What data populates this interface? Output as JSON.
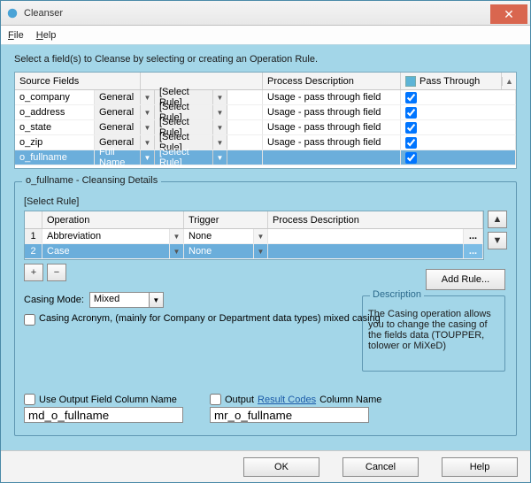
{
  "window": {
    "title": "Cleanser"
  },
  "menu": {
    "file": "File",
    "help": "Help"
  },
  "instruction": "Select a field(s) to Cleanse by selecting or creating an Operation Rule.",
  "grid": {
    "headers": {
      "source": "Source Fields",
      "process": "Process Description",
      "pass": "Pass Through"
    },
    "rows": [
      {
        "name": "o_company",
        "type": "General",
        "rule": "[Select Rule]",
        "desc": "Usage - pass through field",
        "pass": true,
        "selected": false
      },
      {
        "name": "o_address",
        "type": "General",
        "rule": "[Select Rule]",
        "desc": "Usage - pass through field",
        "pass": true,
        "selected": false
      },
      {
        "name": "o_state",
        "type": "General",
        "rule": "[Select Rule]",
        "desc": "Usage - pass through field",
        "pass": true,
        "selected": false
      },
      {
        "name": "o_zip",
        "type": "General",
        "rule": "[Select Rule]",
        "desc": "Usage - pass through field",
        "pass": true,
        "selected": false
      },
      {
        "name": "o_fullname",
        "type": "Full Name",
        "rule": "[Select Rule]",
        "desc": "",
        "pass": true,
        "selected": true
      }
    ]
  },
  "details": {
    "title": "o_fullname - Cleansing Details",
    "rule_label": "[Select Rule]",
    "headers": {
      "op": "Operation",
      "trig": "Trigger",
      "desc": "Process Description"
    },
    "rows": [
      {
        "idx": "1",
        "op": "Abbreviation",
        "trig": "None",
        "desc": "",
        "selected": false
      },
      {
        "idx": "2",
        "op": "Case",
        "trig": "None",
        "desc": "",
        "selected": true
      }
    ],
    "casing_mode_label": "Casing Mode:",
    "casing_mode_value": "Mixed",
    "acronym_label": "Casing Acronym, (mainly for Company or Department data types) mixed casing",
    "add_rule": "Add Rule...",
    "desc_title": "Description",
    "desc_body": "The Casing operation allows you to change the casing of the fields data (TOUPPER, tolower or MiXeD)"
  },
  "output": {
    "use_label": "Use Output Field Column Name",
    "use_value": "md_o_fullname",
    "result_prefix": "Output ",
    "result_link": "Result Codes",
    "result_suffix": " Column Name",
    "result_value": "mr_o_fullname"
  },
  "buttons": {
    "ok": "OK",
    "cancel": "Cancel",
    "help": "Help"
  },
  "glyph": {
    "caret": "▼",
    "up": "▲",
    "down": "▼",
    "plus": "+",
    "minus": "−",
    "more": "...",
    "close": "✕"
  }
}
